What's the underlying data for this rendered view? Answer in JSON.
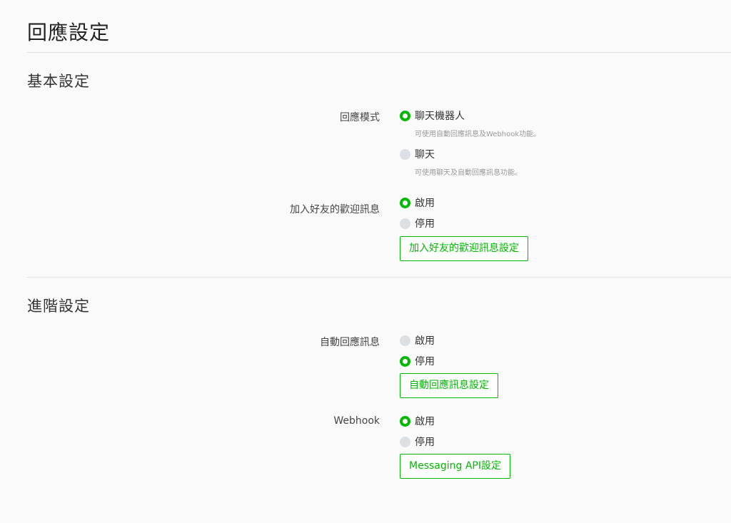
{
  "page_title": "回應設定",
  "accent_color": "#00b900",
  "basic": {
    "title": "基本設定",
    "response_mode": {
      "label": "回應模式",
      "options": [
        {
          "label": "聊天機器人",
          "desc": "可使用自動回應訊息及Webhook功能。",
          "selected": true
        },
        {
          "label": "聊天",
          "desc": "可使用聊天及自動回應訊息功能。",
          "selected": false
        }
      ]
    },
    "welcome": {
      "label": "加入好友的歡迎訊息",
      "options": [
        {
          "label": "啟用",
          "selected": true
        },
        {
          "label": "停用",
          "selected": false
        }
      ],
      "button": "加入好友的歡迎訊息設定"
    }
  },
  "advanced": {
    "title": "進階設定",
    "auto_reply": {
      "label": "自動回應訊息",
      "options": [
        {
          "label": "啟用",
          "selected": false
        },
        {
          "label": "停用",
          "selected": true
        }
      ],
      "button": "自動回應訊息設定"
    },
    "webhook": {
      "label": "Webhook",
      "options": [
        {
          "label": "啟用",
          "selected": true
        },
        {
          "label": "停用",
          "selected": false
        }
      ],
      "button": "Messaging API設定"
    }
  }
}
